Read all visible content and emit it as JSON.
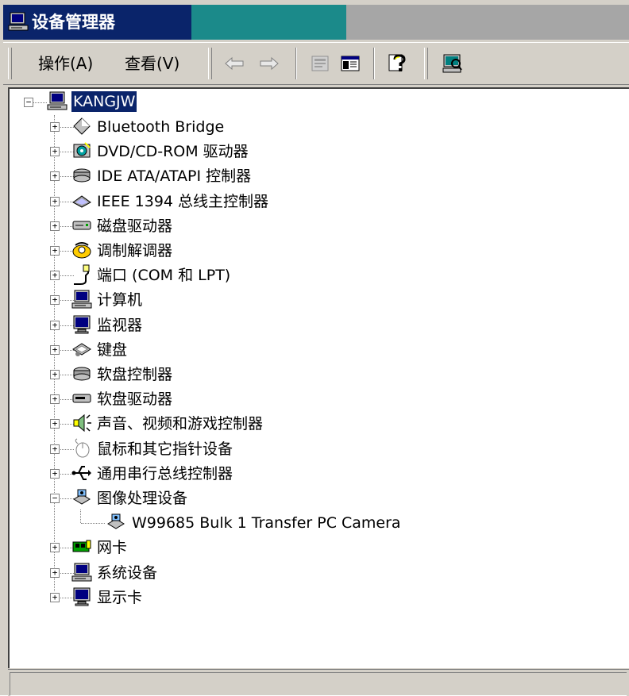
{
  "window": {
    "title": "设备管理器",
    "title_colors": [
      "#0a246a",
      "#1b8a8a",
      "#a6a6a6"
    ]
  },
  "menu": {
    "action_label": "操作(A)",
    "view_label": "查看(V)"
  },
  "toolbar": {
    "icons": [
      "back-arrow-icon",
      "forward-arrow-icon",
      "properties-icon",
      "console-tree-icon",
      "help-icon",
      "scan-hardware-icon"
    ]
  },
  "tree": {
    "root": {
      "label": "KANGJW",
      "icon": "computer-icon",
      "expanded": true
    },
    "categories": [
      {
        "label": "Bluetooth Bridge",
        "icon": "bluetooth-diamond-icon"
      },
      {
        "label": "DVD/CD-ROM 驱动器",
        "icon": "cdrom-icon"
      },
      {
        "label": "IDE ATA/ATAPI 控制器",
        "icon": "ide-controller-icon"
      },
      {
        "label": "IEEE 1394 总线主控制器",
        "icon": "ieee1394-icon"
      },
      {
        "label": "磁盘驱动器",
        "icon": "disk-drive-icon"
      },
      {
        "label": "调制解调器",
        "icon": "modem-icon"
      },
      {
        "label": "端口 (COM 和 LPT)",
        "icon": "port-icon"
      },
      {
        "label": "计算机",
        "icon": "computer-icon"
      },
      {
        "label": "监视器",
        "icon": "monitor-icon"
      },
      {
        "label": "键盘",
        "icon": "keyboard-icon"
      },
      {
        "label": "软盘控制器",
        "icon": "floppy-controller-icon"
      },
      {
        "label": "软盘驱动器",
        "icon": "floppy-drive-icon"
      },
      {
        "label": "声音、视频和游戏控制器",
        "icon": "speaker-icon"
      },
      {
        "label": "鼠标和其它指针设备",
        "icon": "mouse-icon"
      },
      {
        "label": "通用串行总线控制器",
        "icon": "usb-icon"
      },
      {
        "label": "图像处理设备",
        "icon": "imaging-device-icon",
        "expanded": true,
        "children": [
          {
            "label": "W99685 Bulk 1 Transfer PC Camera",
            "icon": "camera-icon"
          }
        ]
      },
      {
        "label": "网卡",
        "icon": "network-card-icon"
      },
      {
        "label": "系统设备",
        "icon": "system-device-icon"
      },
      {
        "label": "显示卡",
        "icon": "display-adapter-icon"
      }
    ]
  },
  "statusbar": {
    "text": ""
  }
}
